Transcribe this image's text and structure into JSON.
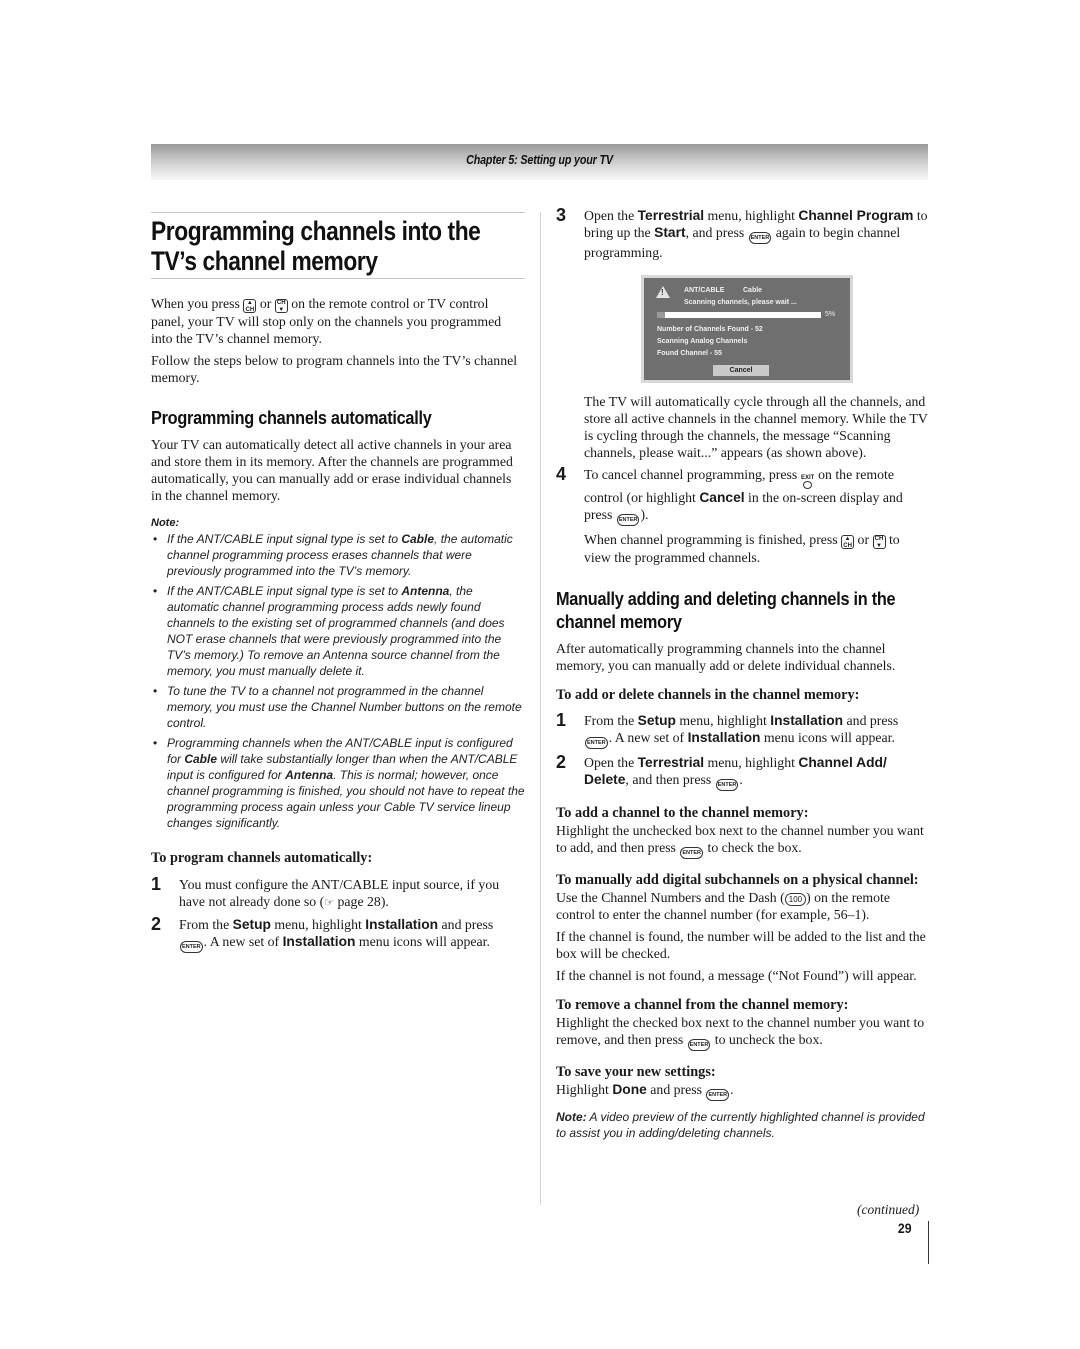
{
  "header": {
    "chapter": "Chapter 5: Setting up your TV"
  },
  "left": {
    "title": "Programming channels into the TV’s channel memory",
    "intro_p1_a": "When you press",
    "intro_p1_or": "or",
    "intro_p1_b": "on the remote control or TV control panel, your TV will stop only on the channels you programmed into the TV’s channel memory.",
    "intro_p2": "Follow the steps below to program channels into the TV’s channel memory.",
    "section_auto": {
      "heading": "Programming channels automatically",
      "body": "Your TV can automatically detect all active channels in your area and store them in its memory. After the channels are programmed automatically, you can manually add or erase individual channels in the channel memory.",
      "note_label": "Note:",
      "notes": [
        {
          "pre": "If the ANT/CABLE input signal type is set to ",
          "bold": "Cable",
          "post": ", the automatic channel programming process erases channels that were previously programmed into the TV’s memory."
        },
        {
          "pre": "If the ANT/CABLE input signal type is set to ",
          "bold": "Antenna",
          "post": ", the automatic channel programming process adds newly found channels to the existing set of programmed channels (and does NOT erase channels that were previously programmed into the TV’s memory.) To remove an Antenna source channel from the memory, you must manually delete it."
        },
        {
          "text": "To tune the TV to a channel not programmed in the channel memory, you must use the Channel Number buttons on the remote control."
        },
        {
          "pre": "Programming channels when the ANT/CABLE input is configured for ",
          "bold": "Cable",
          "mid": " will take substantially longer than when the ANT/CABLE input is configured for ",
          "bold2": "Antenna",
          "post": ". This is normal; however, once channel programming is finished, you should not have to repeat the programming process again unless your Cable TV service lineup changes significantly."
        }
      ],
      "bullet": "•"
    },
    "procedure": {
      "heading": "To program channels automatically:",
      "step1": {
        "num": "1",
        "text_a": "You must configure the ANT/CABLE input source, if you have not already done so (",
        "ref_icon": "☞",
        "text_b": " page 28)."
      },
      "step2": {
        "num": "2",
        "t1": "From the ",
        "b1": "Setup",
        "t2": " menu, highlight ",
        "b2": "Installation",
        "t3": " and press ",
        "t4": ". A new set of ",
        "b3": "Installation",
        "t5": " menu icons will appear."
      }
    }
  },
  "right": {
    "step3": {
      "num": "3",
      "t1": "Open the ",
      "b1": "Terrestrial",
      "t2": " menu, highlight ",
      "b2": "Channel Program",
      "t3": " to bring up the ",
      "b3": "Start",
      "t4": ", and press ",
      "t5": " again to begin channel programming."
    },
    "dialog": {
      "input_label": "ANT/CABLE",
      "input_value": "Cable",
      "status": "Scanning channels, please wait ...",
      "progress_percent": 5,
      "progress_label": "5%",
      "line1": "Number of Channels Found - 52",
      "line2": "Scanning Analog Channels",
      "line3": "Found Channel - 55",
      "cancel_label": "Cancel"
    },
    "after_dialog": "The TV will automatically cycle through all the channels, and store all active channels in the channel memory. While the TV is cycling through the channels, the message “Scanning channels, please wait...” appears (as shown above).",
    "step4": {
      "num": "4",
      "t1": "To cancel channel programming, press ",
      "t2": " on the remote control (or highlight ",
      "b1": "Cancel",
      "t3": " in the on-screen display and press ",
      "t4": ").",
      "p2a": "When channel programming is finished, press ",
      "p2or": " or ",
      "p2b": " to view the programmed channels."
    },
    "section_manual": {
      "heading": "Manually adding and deleting channels in the channel memory",
      "body": "After automatically programming channels into the channel memory, you can manually add or delete individual channels.",
      "sub1": "To add or delete channels in the channel memory:",
      "step1": {
        "num": "1",
        "t1": "From the ",
        "b1": "Setup",
        "t2": " menu, highlight ",
        "b2": "Installation",
        "t3": " and press ",
        "t4": ". A new set of ",
        "b3": "Installation",
        "t5": " menu icons will appear."
      },
      "step2": {
        "num": "2",
        "t1": "Open the ",
        "b1": "Terrestrial",
        "t2": " menu, highlight ",
        "b2": "Channel Add/ Delete",
        "t3": ", and then press ",
        "t4": "."
      },
      "sub2": "To add a channel to the channel memory:",
      "sub2_body_a": "Highlight the unchecked box next to the channel number you want to add, and then press ",
      "sub2_body_b": " to check the box.",
      "sub3": "To manually add digital subchannels on a physical channel:",
      "sub3_p1_a": "Use the Channel Numbers and the Dash (",
      "sub3_p1_b": ") on the remote control to enter the channel number (for example, 56–1).",
      "sub3_p2": "If the channel is found, the number will be added to the list and the box will be checked.",
      "sub3_p3": "If the channel is not found, a message (“Not Found”) will appear.",
      "sub4": "To remove a channel from the channel memory:",
      "sub4_body_a": "Highlight the checked box next to the channel number you want to remove, and then press ",
      "sub4_body_b": " to uncheck the box.",
      "sub5": "To save your new settings:",
      "sub5_a": "Highlight ",
      "sub5_b": "Done",
      "sub5_c": " and press ",
      "sub5_d": ".",
      "note_label": "Note:",
      "note_text": " A video preview of the currently highlighted channel is provided to assist you in adding/deleting channels."
    }
  },
  "keys": {
    "enter": "ENTER",
    "ch": "CH",
    "ch_up": "▲",
    "ch_down": "▼",
    "exit": "EXIT",
    "dash": "100"
  },
  "footer": {
    "continued": "(continued)",
    "page_number": "29"
  }
}
